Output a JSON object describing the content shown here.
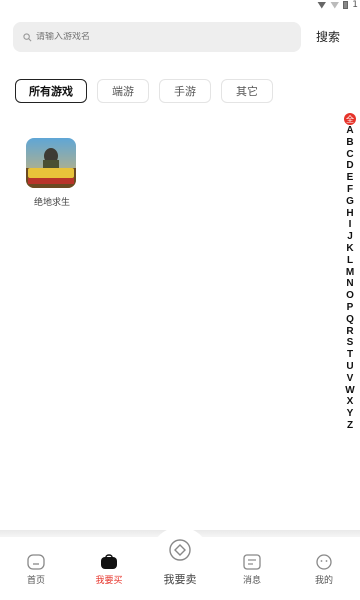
{
  "status_bar": {
    "time_fragment": "1"
  },
  "search": {
    "placeholder": "请输入游戏名",
    "button_label": "搜索"
  },
  "tabs": [
    {
      "label": "所有游戏",
      "active": true
    },
    {
      "label": "端游",
      "active": false
    },
    {
      "label": "手游",
      "active": false
    },
    {
      "label": "其它",
      "active": false
    }
  ],
  "games": [
    {
      "name": "绝地求生",
      "icon": "pubg-game-icon"
    }
  ],
  "alphabet": {
    "all_label": "全",
    "letters": [
      "A",
      "B",
      "C",
      "D",
      "E",
      "F",
      "G",
      "H",
      "I",
      "J",
      "K",
      "L",
      "M",
      "N",
      "O",
      "P",
      "Q",
      "R",
      "S",
      "T",
      "U",
      "V",
      "W",
      "X",
      "Y",
      "Z"
    ]
  },
  "bottom_nav": [
    {
      "label": "首页",
      "icon": "home-icon",
      "active": false
    },
    {
      "label": "我要买",
      "icon": "shopping-bag-icon",
      "active": true
    },
    {
      "label": "我要卖",
      "icon": "sell-icon",
      "active": false
    },
    {
      "label": "消息",
      "icon": "message-icon",
      "active": false
    },
    {
      "label": "我的",
      "icon": "profile-icon",
      "active": false
    }
  ],
  "colors": {
    "accent": "#e6332a",
    "search_bg": "#eeeeee",
    "text": "#222222"
  }
}
